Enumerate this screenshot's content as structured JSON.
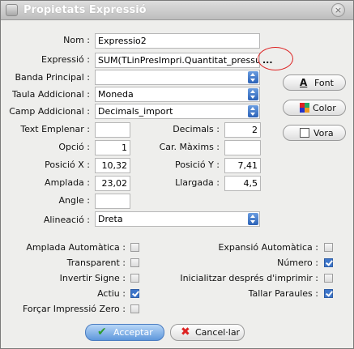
{
  "window": {
    "title": "Propietats Expressió",
    "close": "×"
  },
  "labels": {
    "nom": "Nom :",
    "expressio": "Expressió :",
    "banda": "Banda Principal :",
    "taula": "Taula Addicional :",
    "camp": "Camp Addicional :",
    "text_emplenar": "Text Emplenar :",
    "decimals": "Decimals :",
    "opcio": "Opció :",
    "car_maxims": "Car. Màxims :",
    "posicio_x": "Posició X :",
    "posicio_y": "Posició Y :",
    "amplada": "Amplada :",
    "llargada": "Llargada :",
    "angle": "Angle :",
    "alineacio": "Alineació :"
  },
  "fields": {
    "nom": "Expressio2",
    "expressio": "SUM(TLinPresImpri.Quantitat_pressupost",
    "expressio_button": "...",
    "banda": "",
    "taula": "Moneda",
    "camp": "Decimals_import",
    "text_emplenar": "",
    "decimals": "2",
    "opcio": "1",
    "car_maxims": "",
    "posicio_x": "10,32",
    "posicio_y": "7,41",
    "amplada": "23,02",
    "llargada": "4,5",
    "angle": "",
    "alineacio": "Dreta"
  },
  "side_buttons": {
    "font": "Font",
    "font_icon": "A",
    "color": "Color",
    "vora": "Vora"
  },
  "checks_left": [
    {
      "label": "Amplada Automàtica :",
      "checked": false
    },
    {
      "label": "Transparent :",
      "checked": false
    },
    {
      "label": "Invertir Signe :",
      "checked": false
    },
    {
      "label": "Actiu :",
      "checked": true
    },
    {
      "label": "Forçar Impressió Zero :",
      "checked": false
    }
  ],
  "checks_right": [
    {
      "label": "Expansió Automàtica :",
      "checked": false
    },
    {
      "label": "Número :",
      "checked": true
    },
    {
      "label": "Inicialitzar després d'imprimir :",
      "checked": false
    },
    {
      "label": "Tallar Paraules :",
      "checked": true
    }
  ],
  "footer": {
    "accept": "Acceptar",
    "cancel": "Cancel·lar"
  },
  "colors": {
    "accent": "#3d75c9",
    "annotation": "#dd2222"
  }
}
